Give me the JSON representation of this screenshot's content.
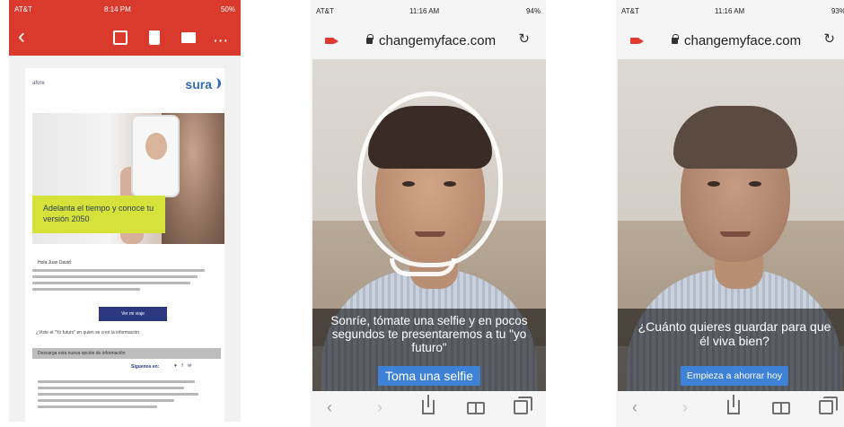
{
  "phone1": {
    "status": {
      "carrier": "AT&T",
      "time": "8:14 PM",
      "battery": "50%"
    },
    "email": {
      "sender": "afore",
      "brand": "sura",
      "banner_text": "Adelanta el tiempo y conoce tu versión 2050",
      "greeting": "Hola Juan David:",
      "cta_label": "Ver mi viaje",
      "note": "¿Viste el \"Yo futuro\" en quien se creó la información",
      "grey_bar_text": "Descarga esta nueva opción de información",
      "share_label": "Síguenos en:",
      "share_icons": "♥ f ✉"
    }
  },
  "phone2": {
    "status": {
      "carrier": "AT&T",
      "time": "11:16 AM",
      "battery": "94%"
    },
    "url": "changemyface.com",
    "caption": "Sonríe, tómate una selfie y en pocos segundos te presentaremos a tu \"yo futuro\"",
    "button_label": "Toma una selfie"
  },
  "phone3": {
    "status": {
      "carrier": "AT&T",
      "time": "11:16 AM",
      "battery": "93%"
    },
    "url": "changemyface.com",
    "caption": "¿Cuánto quieres guardar para que él viva bien?",
    "button_label": "Empieza a ahorrar hoy"
  },
  "nav": {
    "back": "‹",
    "forward": "›"
  },
  "colors": {
    "mail_header": "#d93a2b",
    "primary_button": "#3d82d6",
    "banner": "#d6e23a",
    "brand_blue": "#2f6cb7"
  }
}
